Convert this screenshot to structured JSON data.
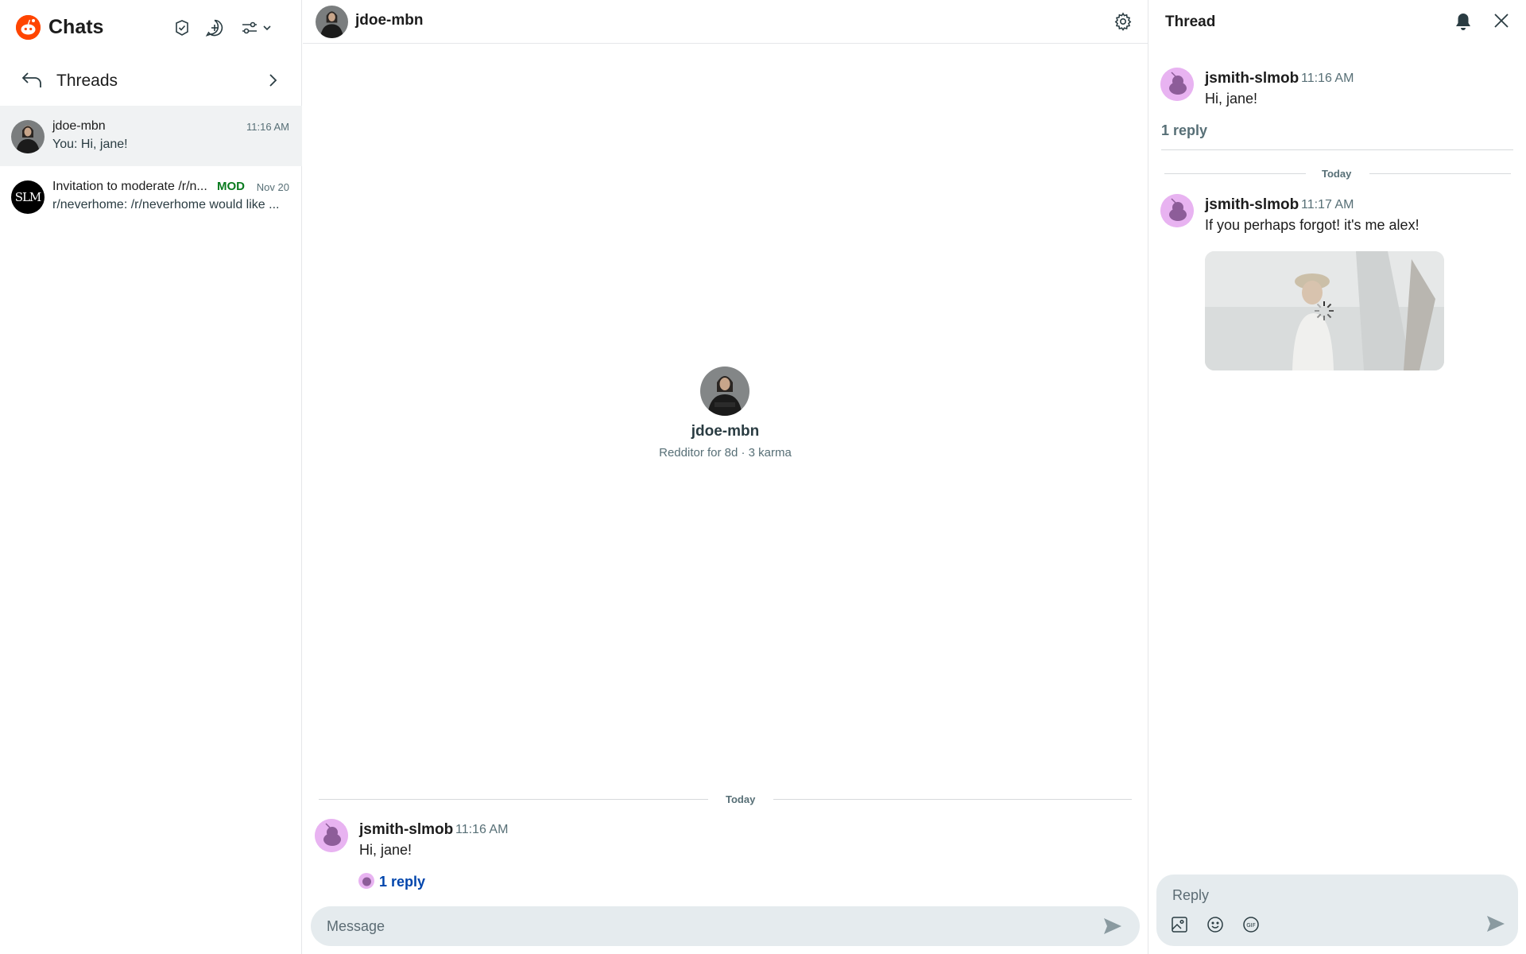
{
  "sidebar": {
    "title": "Chats",
    "threads_label": "Threads",
    "conversations": [
      {
        "name": "jdoe-mbn",
        "time": "11:16 AM",
        "preview": "You: Hi, jane!"
      },
      {
        "name": "Invitation to moderate /r/n...",
        "badge": "MOD",
        "time": "Nov 20",
        "preview": "r/neverhome: /r/neverhome would like ...",
        "avatar_text": "SLM"
      }
    ]
  },
  "chat": {
    "title": "jdoe-mbn",
    "profile": {
      "name": "jdoe-mbn",
      "meta": "Redditor for 8d  ·  3 karma"
    },
    "day_label": "Today",
    "message": {
      "user": "jsmith-slmob",
      "time": "11:16 AM",
      "text": "Hi, jane!",
      "reply_count": "1 reply"
    },
    "composer_placeholder": "Message"
  },
  "thread": {
    "title": "Thread",
    "root": {
      "user": "jsmith-slmob",
      "time": "11:16 AM",
      "text": "Hi, jane!"
    },
    "reply_count": "1 reply",
    "day_label": "Today",
    "reply": {
      "user": "jsmith-slmob",
      "time": "11:17 AM",
      "text": "If you perhaps forgot! it's me alex!"
    },
    "reply_placeholder": "Reply"
  },
  "colors": {
    "accent": "#ff4500",
    "link": "#0045ac",
    "mod": "#0a7b1f",
    "avatar_bg": "#e8b3f1"
  }
}
